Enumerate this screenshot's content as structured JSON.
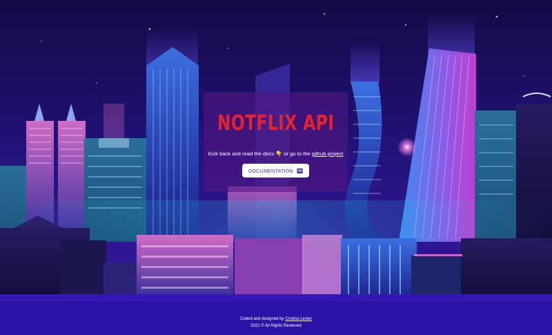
{
  "hero": {
    "title": "NOTFLIX API",
    "subtitle_prefix": "Kick back and read the docs",
    "subtitle_middle": "or go to the",
    "github_link": "github project",
    "doc_button_label": "DOCUMENTATION"
  },
  "footer": {
    "credit_prefix": "Coded and designed by",
    "author_link": "Cristina Lester",
    "copyright": "2021 © All Rights Reserved"
  },
  "colors": {
    "title": "#e3242d",
    "button_text": "#4b2ab0",
    "footer_bg": "#2d12a6"
  }
}
